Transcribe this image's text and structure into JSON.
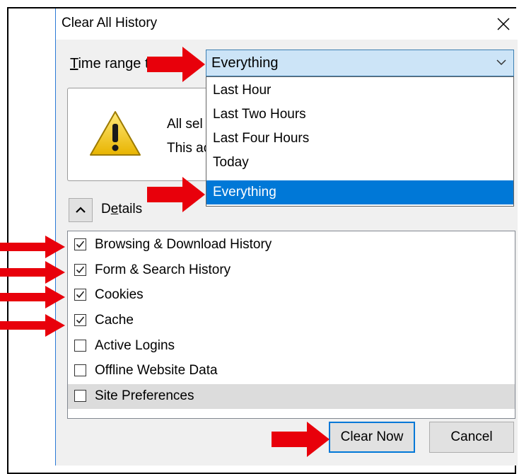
{
  "dialog": {
    "title": "Clear All History",
    "time_range_label_underlined": "T",
    "time_range_label_rest": "ime range t",
    "selected_range": "Everything"
  },
  "dropdown": {
    "options": [
      "Last Hour",
      "Last Two Hours",
      "Last Four Hours",
      "Today",
      "Everything"
    ],
    "selected_index": 4
  },
  "warning": {
    "line1_visible": "All sel",
    "line2_visible": "This ac"
  },
  "details": {
    "label_first": "D",
    "label_underlined": "e",
    "label_rest": "tails"
  },
  "items": [
    {
      "label": "Browsing & Download History",
      "checked": true
    },
    {
      "label": "Form & Search History",
      "checked": true
    },
    {
      "label": "Cookies",
      "checked": true
    },
    {
      "label": "Cache",
      "checked": true
    },
    {
      "label": "Active Logins",
      "checked": false
    },
    {
      "label": "Offline Website Data",
      "checked": false
    },
    {
      "label": "Site Preferences",
      "checked": false
    }
  ],
  "buttons": {
    "clear_now": "Clear Now",
    "cancel": "Cancel"
  },
  "colors": {
    "annotation_arrow": "#e8000b",
    "selection": "#0078d7"
  },
  "icons": {
    "close": "close-icon",
    "chevron": "chevron-down-icon",
    "warning": "warning-icon",
    "collapse": "chevron-up-icon",
    "checkmark": "checkmark-icon",
    "arrow": "red-arrow-annotation"
  }
}
